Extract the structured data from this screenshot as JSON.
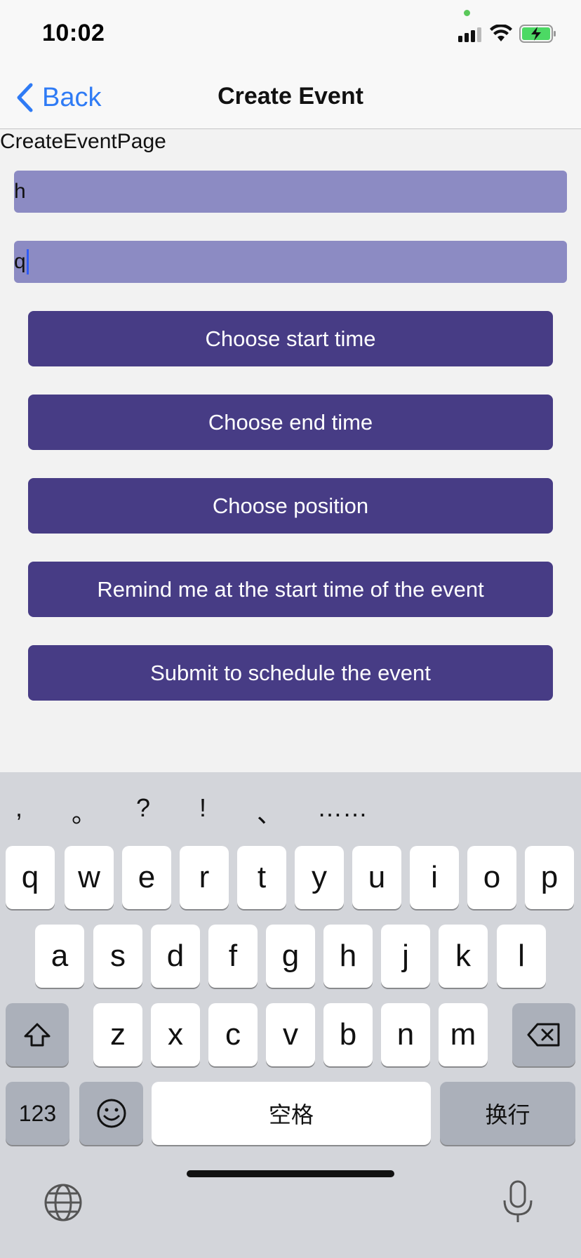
{
  "status_bar": {
    "time": "10:02"
  },
  "nav": {
    "back_label": "Back",
    "title": "Create Event"
  },
  "page": {
    "label": "CreateEventPage",
    "fields": [
      {
        "value": "h"
      },
      {
        "value": "q"
      }
    ],
    "buttons": [
      {
        "label": "Choose start time"
      },
      {
        "label": "Choose end time"
      },
      {
        "label": "Choose position"
      },
      {
        "label": "Remind me at the start time of the event"
      },
      {
        "label": "Submit to schedule the event"
      }
    ]
  },
  "keyboard": {
    "punctuation": [
      ",",
      "。",
      "?",
      "!",
      "、",
      "……"
    ],
    "row1": [
      "q",
      "w",
      "e",
      "r",
      "t",
      "y",
      "u",
      "i",
      "o",
      "p"
    ],
    "row2": [
      "a",
      "s",
      "d",
      "f",
      "g",
      "h",
      "j",
      "k",
      "l"
    ],
    "row3": [
      "z",
      "x",
      "c",
      "v",
      "b",
      "n",
      "m"
    ],
    "numbers_label": "123",
    "space_label": "空格",
    "return_label": "换行"
  },
  "colors": {
    "accent": "#2f7bf5",
    "field_bg": "#8c8bc3",
    "button_bg": "#473c85"
  }
}
